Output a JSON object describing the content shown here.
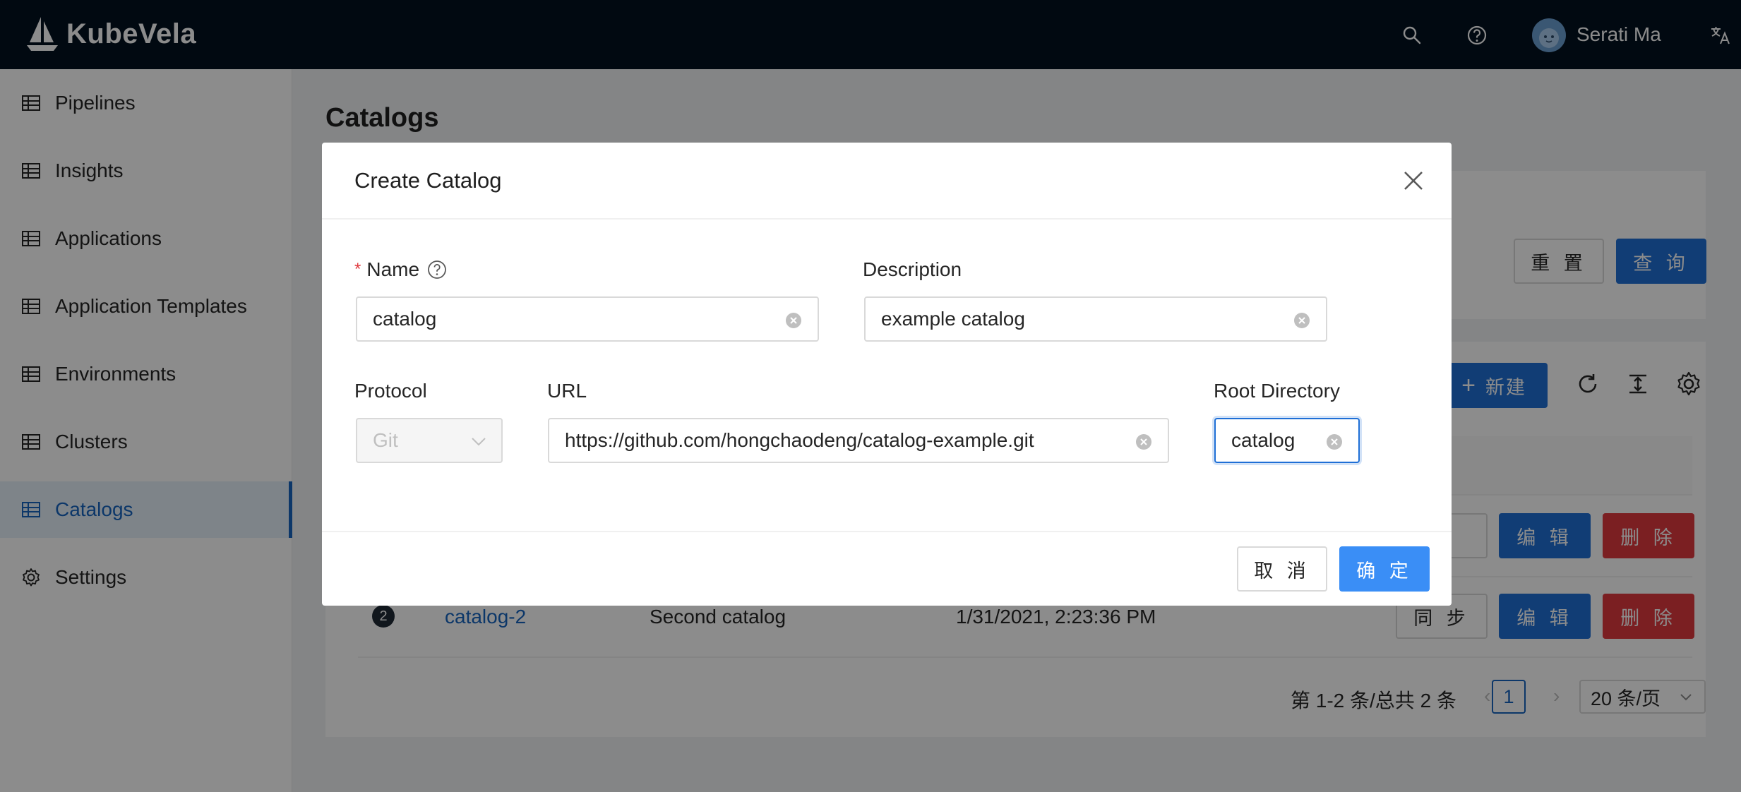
{
  "header": {
    "brand": "KubeVela",
    "user_name": "Serati Ma"
  },
  "sidebar": {
    "items": [
      {
        "label": "Pipelines",
        "icon": "table-icon"
      },
      {
        "label": "Insights",
        "icon": "table-icon"
      },
      {
        "label": "Applications",
        "icon": "table-icon"
      },
      {
        "label": "Application Templates",
        "icon": "table-icon"
      },
      {
        "label": "Environments",
        "icon": "table-icon"
      },
      {
        "label": "Clusters",
        "icon": "table-icon"
      },
      {
        "label": "Catalogs",
        "icon": "table-icon",
        "active": true
      },
      {
        "label": "Settings",
        "icon": "gear-icon"
      }
    ]
  },
  "page": {
    "title": "Catalogs",
    "reset_label": "重 置",
    "query_label": "查 询",
    "new_label": "新建"
  },
  "table": {
    "rows": [
      {
        "index": "2",
        "name": "catalog-2",
        "description": "Second catalog",
        "time": "1/31/2021, 2:23:36 PM",
        "sync_label": "同 步",
        "edit_label": "编 辑",
        "delete_label": "删 除"
      }
    ],
    "partial_row": {
      "sync_label": "步",
      "edit_label": "编 辑",
      "delete_label": "删 除"
    }
  },
  "pagination": {
    "summary": "第 1-2 条/总共 2 条",
    "current_page": "1",
    "page_size": "20 条/页"
  },
  "modal": {
    "title": "Create Catalog",
    "name_label": "Name",
    "name_value": "catalog",
    "description_label": "Description",
    "description_value": "example catalog",
    "protocol_label": "Protocol",
    "protocol_value": "Git",
    "url_label": "URL",
    "url_value": "https://github.com/hongchaodeng/catalog-example.git",
    "root_label": "Root Directory",
    "root_value": "catalog",
    "cancel_label": "取 消",
    "ok_label": "确 定"
  },
  "colors": {
    "primary": "#1f6fd6",
    "danger": "#e0393e",
    "header_bg": "#03111f"
  }
}
